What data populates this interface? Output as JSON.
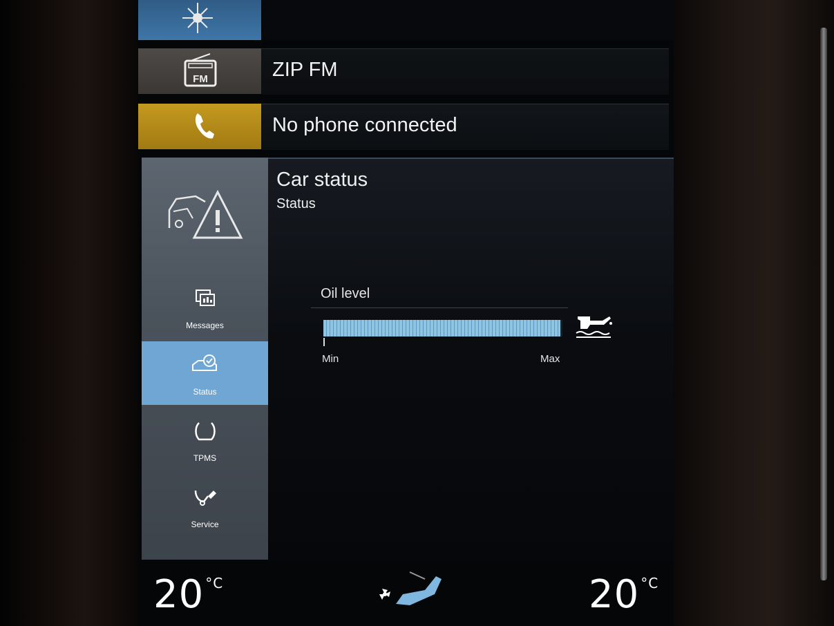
{
  "top_rows": [
    {
      "icon": "navigation-compass-icon",
      "label": ""
    },
    {
      "icon": "fm-radio-icon",
      "label": "ZIP FM"
    },
    {
      "icon": "phone-icon",
      "label": "No phone connected"
    }
  ],
  "car_status": {
    "title": "Car status",
    "subtitle": "Status",
    "oil": {
      "label": "Oil level",
      "level_fraction": 0.99,
      "min_label": "Min",
      "max_label": "Max",
      "icon": "oil-can-icon"
    }
  },
  "sidebar": {
    "main_icon": "car-warning-icon",
    "items": [
      {
        "label": "Messages",
        "icon": "messages-icon",
        "active": false
      },
      {
        "label": "Status",
        "icon": "car-status-icon",
        "active": true
      },
      {
        "label": "TPMS",
        "icon": "tire-pressure-icon",
        "active": false
      },
      {
        "label": "Service",
        "icon": "service-wrench-icon",
        "active": false
      }
    ]
  },
  "climate": {
    "left_temp": "20",
    "right_temp": "20",
    "unit": "°C",
    "center_icon": "seat-fan-icon"
  },
  "colors": {
    "nav_tile": "#3f76a8",
    "phone_tile": "#c59a20",
    "active_item": "#6fa6d4",
    "oil_bar": "#8fc4e3"
  }
}
